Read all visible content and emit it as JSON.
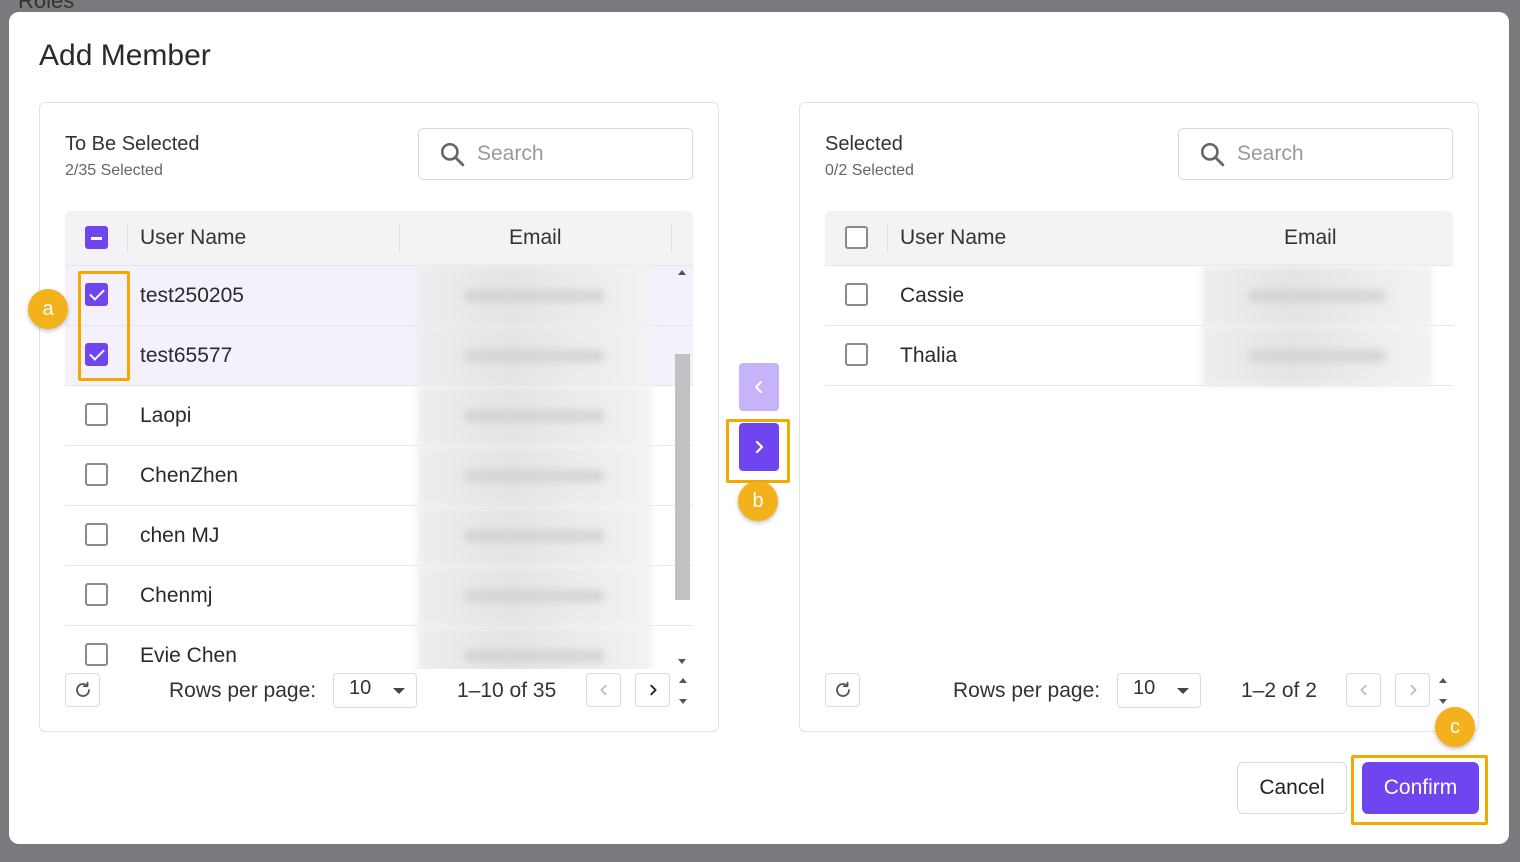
{
  "dialog": {
    "title": "Add Member"
  },
  "left_panel": {
    "title": "To Be Selected",
    "count": "2/35 Selected",
    "search_placeholder": "Search",
    "columns": {
      "name": "User Name",
      "email": "Email"
    },
    "rows": [
      {
        "name": "test250205",
        "checked": true
      },
      {
        "name": "test65577",
        "checked": true
      },
      {
        "name": "Laopi",
        "checked": false
      },
      {
        "name": "ChenZhen",
        "checked": false
      },
      {
        "name": "chen MJ",
        "checked": false
      },
      {
        "name": "Chenmj",
        "checked": false
      },
      {
        "name": "Evie Chen",
        "checked": false
      }
    ],
    "footer": {
      "rows_per_page_label": "Rows per page:",
      "rows_per_page_value": "10",
      "range": "1–10 of 35"
    }
  },
  "right_panel": {
    "title": "Selected",
    "count": "0/2 Selected",
    "search_placeholder": "Search",
    "columns": {
      "name": "User Name",
      "email": "Email"
    },
    "rows": [
      {
        "name": "Cassie",
        "checked": false
      },
      {
        "name": "Thalia",
        "checked": false
      }
    ],
    "footer": {
      "rows_per_page_label": "Rows per page:",
      "rows_per_page_value": "10",
      "range": "1–2 of 2"
    }
  },
  "actions": {
    "cancel_label": "Cancel",
    "confirm_label": "Confirm"
  },
  "annotations": {
    "a": "a",
    "b": "b",
    "c": "c"
  },
  "colors": {
    "accent": "#6f45f0",
    "accent_light": "#c6b3f9",
    "highlight": "#f2a900",
    "marker": "#f3b21b"
  },
  "icons": {
    "search": "search-icon",
    "refresh": "refresh-icon",
    "prev": "chevron-left-icon",
    "next": "chevron-right-icon"
  }
}
